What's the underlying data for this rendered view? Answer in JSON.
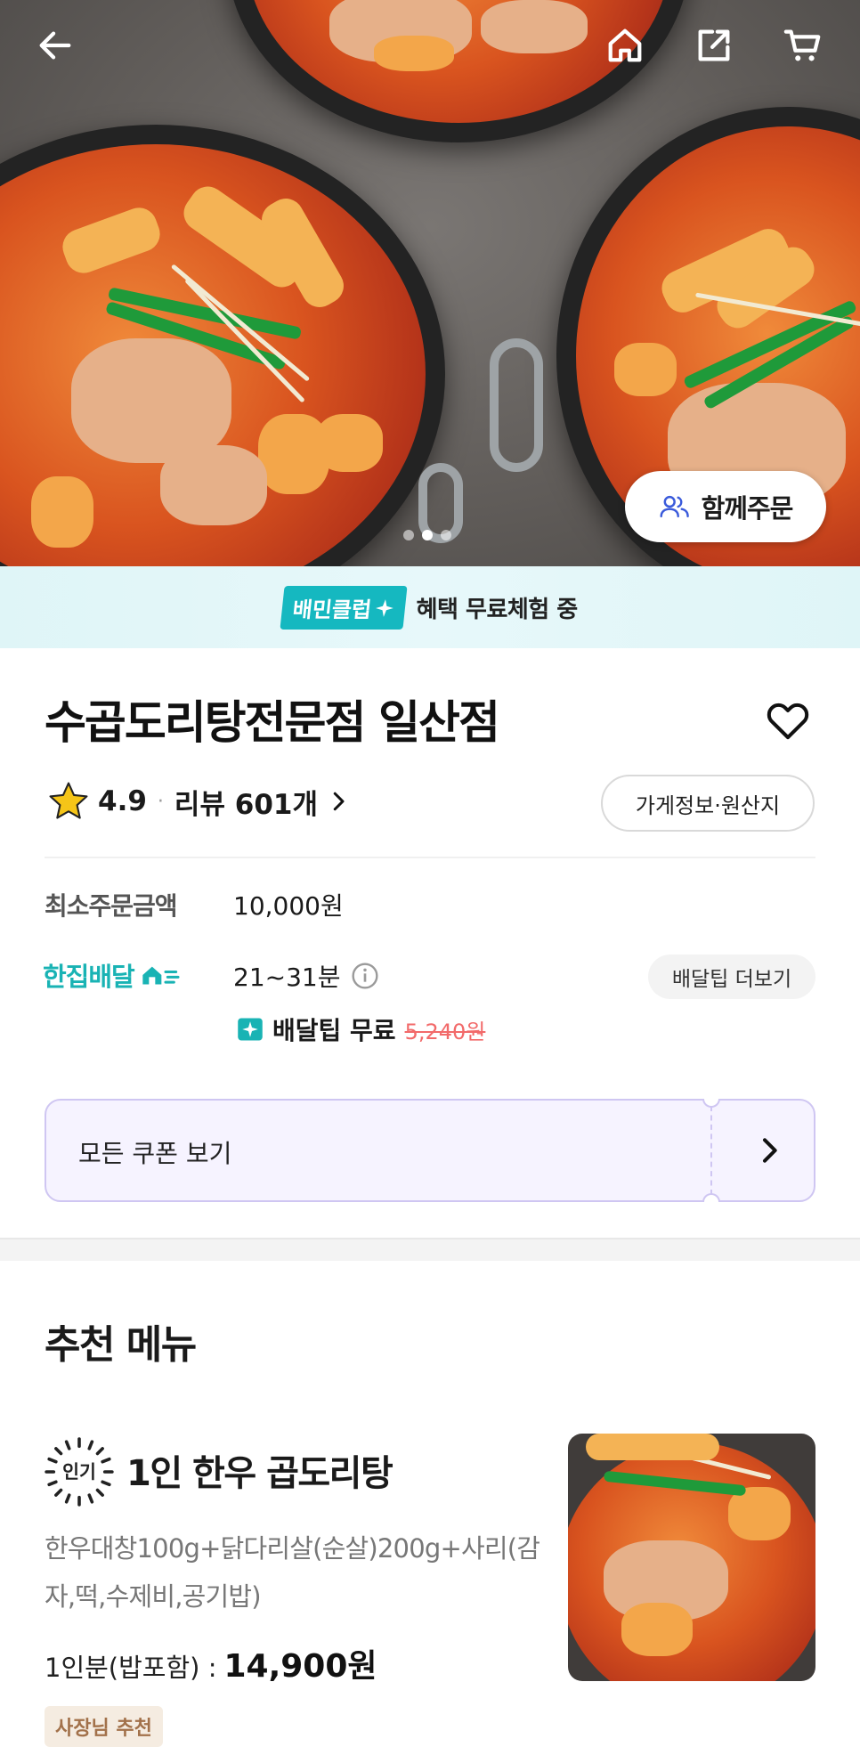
{
  "hero": {
    "together_order_label": "함께주문",
    "carousel": {
      "count": 3,
      "active": 1
    }
  },
  "club_banner": {
    "badge": "배민클럽",
    "text": "혜택 무료체험 중"
  },
  "store": {
    "name": "수곱도리탕전문점 일산점",
    "rating": "4.9",
    "review_label": "리뷰 601개",
    "info_button": "가게정보·원산지",
    "min_order_label": "최소주문금액",
    "min_order_value": "10,000원",
    "delivery_type": "한집배달",
    "delivery_time": "21~31분",
    "tip_more_button": "배달팁 더보기",
    "tip_free_text": "배달팁 무료",
    "tip_original_price": "5,240원"
  },
  "coupon": {
    "label": "모든 쿠폰 보기"
  },
  "recommended": {
    "title": "추천 메뉴",
    "items": [
      {
        "badge": "인기",
        "name": "1인 한우 곱도리탕",
        "description": "한우대창100g+닭다리살(순살)200g+사리(감자,떡,수제비,공기밥)",
        "price_label": "1인분(밥포함) :",
        "price": "14,900원",
        "owner_tag": "사장님 추천"
      }
    ]
  },
  "colors": {
    "accent_mint": "#19b3b4",
    "club_badge": "#15b8c0",
    "coupon_border": "#cfc6f2",
    "coupon_bg": "#f6f3ff",
    "old_price": "#f26a6a",
    "star": "#f5c518"
  },
  "icons": [
    "back-arrow-icon",
    "home-icon",
    "share-icon",
    "cart-icon",
    "people-icon",
    "heart-icon",
    "star-icon",
    "chevron-right-icon",
    "info-icon",
    "house-delivery-icon",
    "sparkle-icon"
  ]
}
